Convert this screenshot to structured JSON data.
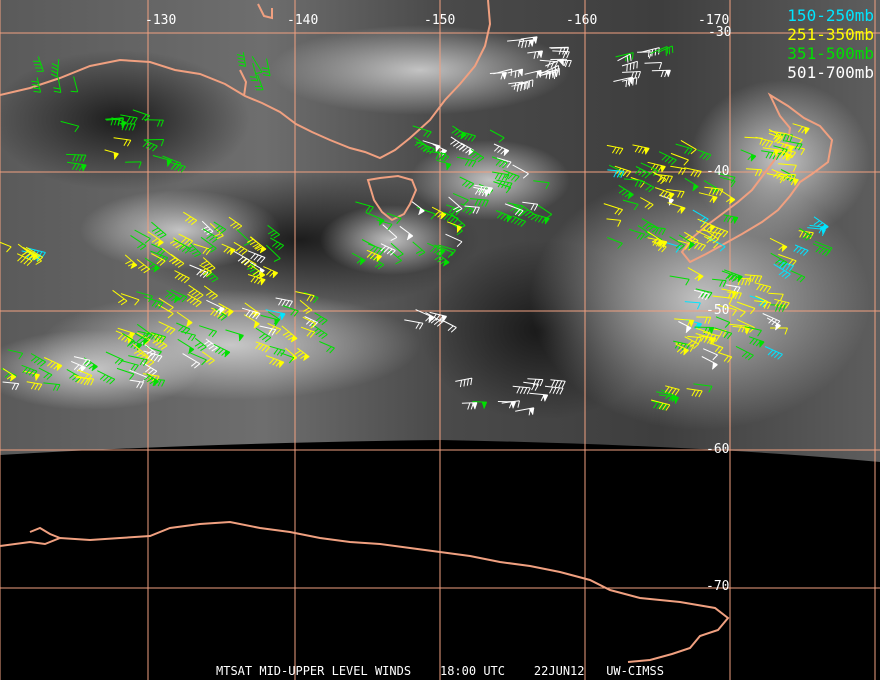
{
  "colors": {
    "grid": "#f0a080",
    "coast": "#f0a080",
    "cloud_dark": "#222222",
    "cloud_light": "#c8c8c8",
    "space": "#000000",
    "text": "#ffffff"
  },
  "legend": [
    {
      "label": "150-250mb",
      "color": "#00e5ff"
    },
    {
      "label": "251-350mb",
      "color": "#ffff00"
    },
    {
      "label": "351-500mb",
      "color": "#00e000"
    },
    {
      "label": "501-700mb",
      "color": "#ffffff"
    }
  ],
  "longitude_labels": [
    "-130",
    "-140",
    "-150",
    "-160",
    "-170"
  ],
  "latitude_labels": [
    "-30",
    "-40",
    "-50",
    "-60",
    "-70"
  ],
  "footer": {
    "product": "MTSAT MID-UPPER LEVEL WINDS",
    "time": "18:00 UTC",
    "date": "22JUN12",
    "source": "UW-CIMSS"
  }
}
